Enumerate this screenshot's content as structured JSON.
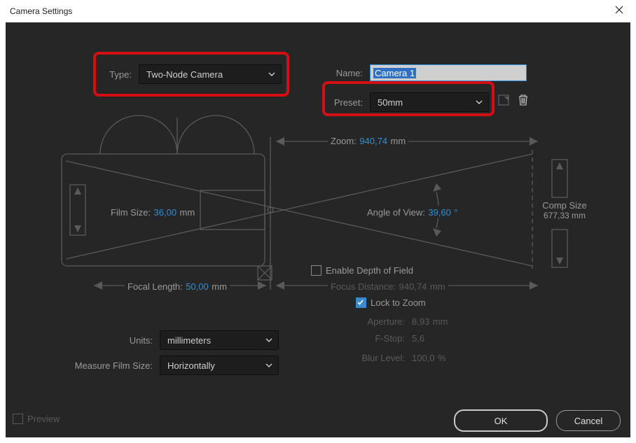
{
  "window": {
    "title": "Camera Settings"
  },
  "fields": {
    "type": {
      "label": "Type:",
      "value": "Two-Node Camera"
    },
    "name": {
      "label": "Name:",
      "value": "Camera 1"
    },
    "preset": {
      "label": "Preset:",
      "value": "50mm"
    },
    "units": {
      "label": "Units:",
      "value": "millimeters"
    },
    "measureFilmSize": {
      "label": "Measure Film Size:",
      "value": "Horizontally"
    }
  },
  "diagram": {
    "zoom": {
      "label": "Zoom:",
      "value": "940,74",
      "unit": "mm"
    },
    "filmSize": {
      "label": "Film Size:",
      "value": "36,00",
      "unit": "mm"
    },
    "angleOfView": {
      "label": "Angle of View:",
      "value": "39,60",
      "unit": "°"
    },
    "compSize": {
      "label": "Comp Size",
      "value": "677,33",
      "unit": "mm"
    },
    "focalLength": {
      "label": "Focal Length:",
      "value": "50,00",
      "unit": "mm"
    }
  },
  "dof": {
    "enable": {
      "label": "Enable Depth of Field",
      "checked": false
    },
    "focusDistance": {
      "label": "Focus Distance:",
      "value": "940,74",
      "unit": "mm"
    },
    "lockToZoom": {
      "label": "Lock to Zoom",
      "checked": true
    },
    "aperture": {
      "label": "Aperture:",
      "value": "8,93",
      "unit": "mm"
    },
    "fstop": {
      "label": "F-Stop:",
      "value": "5,6"
    },
    "blurLevel": {
      "label": "Blur Level:",
      "value": "100,0",
      "unit": "%"
    }
  },
  "footer": {
    "preview": "Preview",
    "ok": "OK",
    "cancel": "Cancel"
  },
  "highlights": [
    "type-field",
    "preset-field"
  ]
}
